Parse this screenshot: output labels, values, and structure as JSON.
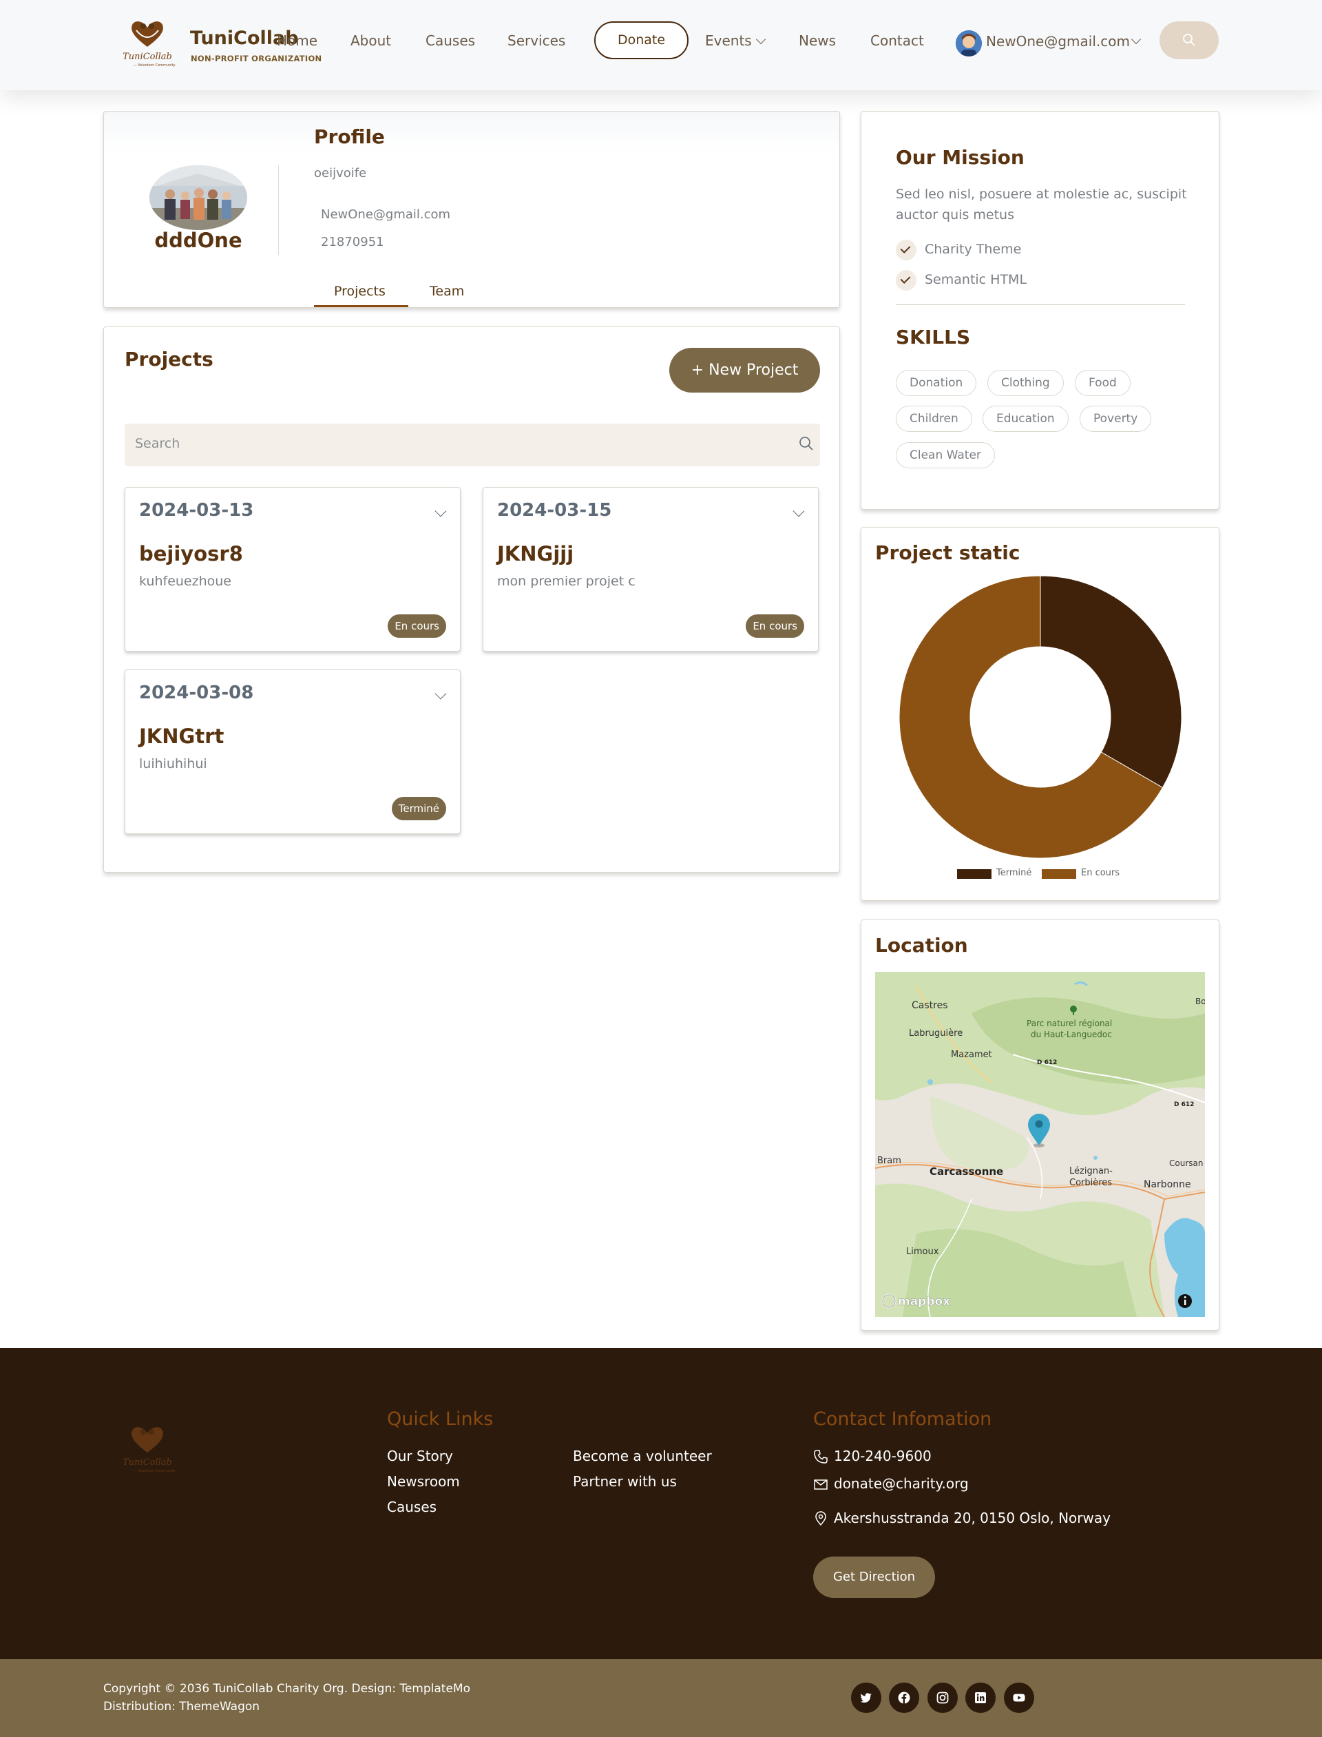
{
  "nav": {
    "brand_name": "TuniCollab",
    "brand_sub": "NON-PROFIT ORGANIZATION",
    "links": {
      "home": "Home",
      "about": "About",
      "causes": "Causes",
      "services": "Services",
      "events": "Events",
      "news": "News",
      "contact": "Contact"
    },
    "donate": "Donate",
    "user_email": "NewOne@gmail.com"
  },
  "profile": {
    "title": "Profile",
    "name": "dddOne",
    "description": "oeijvoife",
    "email": "NewOne@gmail.com",
    "phone": "21870951",
    "tabs": [
      "Projects",
      "Team"
    ],
    "active_tab": "Projects"
  },
  "projects": {
    "title": "Projects",
    "new_button": "+ New Project",
    "search_placeholder": "Search",
    "items": [
      {
        "date": "2024-03-13",
        "name": "bejiyosr8",
        "description": "kuhfeuezhoue",
        "status": "En cours"
      },
      {
        "date": "2024-03-15",
        "name": "JKNGjjj",
        "description": "mon premier projet c",
        "status": "En cours"
      },
      {
        "date": "2024-03-08",
        "name": "JKNGtrt",
        "description": "luihiuhihui",
        "status": "Terminé"
      }
    ]
  },
  "mission": {
    "title": "Our Mission",
    "text": "Sed leo nisl, posuere at molestie ac, suscipit auctor quis metus",
    "checks": [
      "Charity Theme",
      "Semantic HTML"
    ],
    "skills_title": "SKILLS",
    "skills": [
      "Donation",
      "Clothing",
      "Food",
      "Children",
      "Education",
      "Poverty",
      "Clean Water"
    ]
  },
  "stats": {
    "title": "Project static"
  },
  "chart_data": {
    "type": "pie",
    "variant": "doughnut",
    "categories": [
      "Terminé",
      "En cours"
    ],
    "values": [
      1,
      2
    ],
    "colors": [
      "#40220a",
      "#8b5213"
    ],
    "legend": "bottom"
  },
  "location": {
    "title": "Location",
    "labels": {
      "castres": "Castres",
      "labruguiere": "Labruguière",
      "mazamet": "Mazamet",
      "parc1": "Parc naturel régional",
      "parc2": "du Haut-Languedoc",
      "d612a": "D 612",
      "d612b": "D 612",
      "bram": "Bram",
      "carcassonne": "Carcassonne",
      "lezignan1": "Lézignan-",
      "lezignan2": "Corbières",
      "narbonne": "Narbonne",
      "coursan": "Coursan",
      "limoux": "Limoux",
      "bo": "Bo",
      "mapbox": "mapbox"
    }
  },
  "footer": {
    "quick_links_title": "Quick Links",
    "links": [
      "Our Story",
      "Newsroom",
      "Causes",
      "Become a volunteer",
      "Partner with us"
    ],
    "contact_title": "Contact Infomation",
    "phone": "120-240-9600",
    "email": "donate@charity.org",
    "address": "Akershusstranda 20, 0150 Oslo, Norway",
    "direction_button": "Get Direction",
    "copyright": "Copyright © 2036 TuniCollab Charity Org. Design: TemplateMo",
    "distribution": "Distribution: ThemeWagon",
    "social": [
      "twitter-icon",
      "facebook-icon",
      "instagram-icon",
      "linkedin-icon",
      "youtube-icon"
    ]
  },
  "colors": {
    "brand_brown": "#5a3410",
    "accent_olive": "#7a6846",
    "footer_bg": "#2c1a0c",
    "subfooter_bg": "#7a6846"
  }
}
